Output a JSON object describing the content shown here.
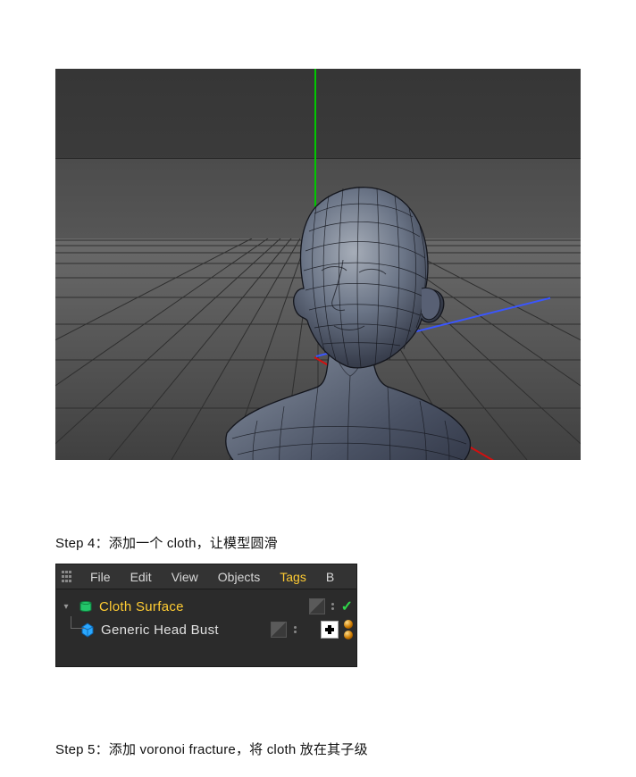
{
  "step4_text": "Step 4：添加一个 cloth，让模型圆滑",
  "step5_text": "Step 5：添加 voronoi fracture，将 cloth 放在其子级",
  "object_manager": {
    "menu": {
      "file": "File",
      "edit": "Edit",
      "view": "View",
      "objects": "Objects",
      "tags": "Tags",
      "bookmarks": "B"
    },
    "items": [
      {
        "name": "Cloth Surface",
        "selected": true,
        "type": "cloth"
      },
      {
        "name": "Generic Head Bust",
        "selected": false,
        "type": "polygon"
      }
    ]
  },
  "viewport": {
    "object_name": "Head Bust (wireframe)"
  }
}
